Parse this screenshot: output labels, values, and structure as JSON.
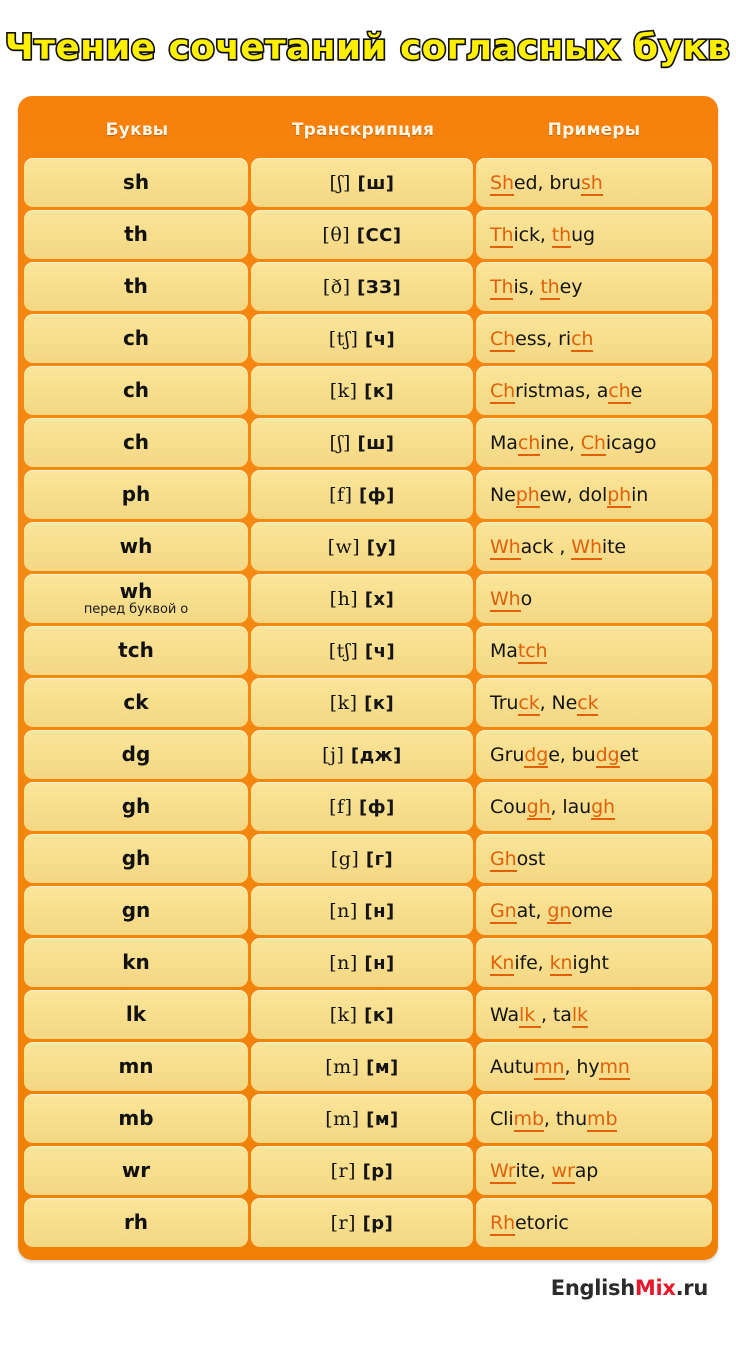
{
  "title": "Чтение сочетаний согласных букв",
  "colors": {
    "panel_orange": "#F6820D",
    "cell_yellow": "#F8E095",
    "highlight_orange": "#E2600A",
    "title_yellow": "#FFF000",
    "title_outline": "#111111",
    "brand_red": "#E8182B"
  },
  "table": {
    "headers": {
      "letters": "Буквы",
      "transcription": "Транскрипция",
      "examples": "Примеры"
    },
    "rows": [
      {
        "letters": "sh",
        "note": "",
        "ipa": "[ʃ]",
        "cyr": "[ш]",
        "example_parts": [
          {
            "t": "S",
            "hl": true
          },
          {
            "t": "h",
            "hl": true
          },
          {
            "t": "ed, bru",
            "hl": false
          },
          {
            "t": "sh",
            "hl": true
          }
        ],
        "example_plain": "Shed, brush"
      },
      {
        "letters": "th",
        "note": "",
        "ipa": "[θ]",
        "cyr": "[СС]",
        "example_parts": [
          {
            "t": "Th",
            "hl": true
          },
          {
            "t": "ick, ",
            "hl": false
          },
          {
            "t": "th",
            "hl": true
          },
          {
            "t": "ug",
            "hl": false
          }
        ],
        "example_plain": "Thick, thug"
      },
      {
        "letters": "th",
        "note": "",
        "ipa": "[ð]",
        "cyr": "[ЗЗ]",
        "example_parts": [
          {
            "t": "Th",
            "hl": true
          },
          {
            "t": "is, ",
            "hl": false
          },
          {
            "t": "th",
            "hl": true
          },
          {
            "t": "ey",
            "hl": false
          }
        ],
        "example_plain": "This, they"
      },
      {
        "letters": "ch",
        "note": "",
        "ipa": "[tʃ]",
        "cyr": "[ч]",
        "example_parts": [
          {
            "t": "Ch",
            "hl": true
          },
          {
            "t": "ess, ri",
            "hl": false
          },
          {
            "t": "ch",
            "hl": true
          }
        ],
        "example_plain": "Chess, rich"
      },
      {
        "letters": "ch",
        "note": "",
        "ipa": "[k]",
        "cyr": "[к]",
        "example_parts": [
          {
            "t": "Ch",
            "hl": true
          },
          {
            "t": "ristmas, a",
            "hl": false
          },
          {
            "t": "ch",
            "hl": true
          },
          {
            "t": "e",
            "hl": false
          }
        ],
        "example_plain": "Christmas, ache"
      },
      {
        "letters": "ch",
        "note": "",
        "ipa": "[ʃ]",
        "cyr": "[ш]",
        "example_parts": [
          {
            "t": "Ma",
            "hl": false
          },
          {
            "t": "ch",
            "hl": true
          },
          {
            "t": "ine, ",
            "hl": false
          },
          {
            "t": "Ch",
            "hl": true
          },
          {
            "t": "icago",
            "hl": false
          }
        ],
        "example_plain": "Machine, Chicago"
      },
      {
        "letters": "ph",
        "note": "",
        "ipa": "[f]",
        "cyr": "[ф]",
        "example_parts": [
          {
            "t": "Ne",
            "hl": false
          },
          {
            "t": "ph",
            "hl": true
          },
          {
            "t": "ew, dol",
            "hl": false
          },
          {
            "t": "ph",
            "hl": true
          },
          {
            "t": "in",
            "hl": false
          }
        ],
        "example_plain": "Nephew, dolphin"
      },
      {
        "letters": "wh",
        "note": "",
        "ipa": "[w]",
        "cyr": "[у]",
        "example_parts": [
          {
            "t": "Wh",
            "hl": true
          },
          {
            "t": "ack , ",
            "hl": false
          },
          {
            "t": "Wh",
            "hl": true
          },
          {
            "t": "ite",
            "hl": false
          }
        ],
        "example_plain": "Whack , White"
      },
      {
        "letters": "wh",
        "note": "перед буквой o",
        "ipa": "[h]",
        "cyr": "[х]",
        "example_parts": [
          {
            "t": "Wh",
            "hl": true
          },
          {
            "t": "o",
            "hl": false
          }
        ],
        "example_plain": "Who"
      },
      {
        "letters": "tch",
        "note": "",
        "ipa": "[tʃ]",
        "cyr": "[ч]",
        "example_parts": [
          {
            "t": "Ma",
            "hl": false
          },
          {
            "t": "tch",
            "hl": true
          }
        ],
        "example_plain": "Match"
      },
      {
        "letters": "ck",
        "note": "",
        "ipa": "[k]",
        "cyr": "[к]",
        "example_parts": [
          {
            "t": "Tru",
            "hl": false
          },
          {
            "t": "ck",
            "hl": true
          },
          {
            "t": ", Ne",
            "hl": false
          },
          {
            "t": "ck",
            "hl": true
          }
        ],
        "example_plain": "Truck, Neck"
      },
      {
        "letters": "dg",
        "note": "",
        "ipa": "[j]",
        "cyr": "[дж]",
        "example_parts": [
          {
            "t": "Gru",
            "hl": false
          },
          {
            "t": "dg",
            "hl": true
          },
          {
            "t": "e, bu",
            "hl": false
          },
          {
            "t": "dg",
            "hl": true
          },
          {
            "t": "et",
            "hl": false
          }
        ],
        "example_plain": "Grudge, budget"
      },
      {
        "letters": "gh",
        "note": "",
        "ipa": "[f]",
        "cyr": "[ф]",
        "example_parts": [
          {
            "t": "Cou",
            "hl": false
          },
          {
            "t": "gh",
            "hl": true
          },
          {
            "t": ", lau",
            "hl": false
          },
          {
            "t": "gh",
            "hl": true
          }
        ],
        "example_plain": "Cough, laugh"
      },
      {
        "letters": "gh",
        "note": "",
        "ipa": "[g]",
        "cyr": "[г]",
        "example_parts": [
          {
            "t": "Gh",
            "hl": true
          },
          {
            "t": "ost",
            "hl": false
          }
        ],
        "example_plain": "Ghost"
      },
      {
        "letters": "gn",
        "note": "",
        "ipa": "[n]",
        "cyr": "[н]",
        "example_parts": [
          {
            "t": "Gn",
            "hl": true
          },
          {
            "t": "at, ",
            "hl": false
          },
          {
            "t": "gn",
            "hl": true
          },
          {
            "t": "ome",
            "hl": false
          }
        ],
        "example_plain": "Gnat, gnome"
      },
      {
        "letters": "kn",
        "note": "",
        "ipa": "[n]",
        "cyr": "[н]",
        "example_parts": [
          {
            "t": "Kn",
            "hl": true
          },
          {
            "t": "ife, ",
            "hl": false
          },
          {
            "t": "kn",
            "hl": true
          },
          {
            "t": "ight",
            "hl": false
          }
        ],
        "example_plain": "Knife, knight"
      },
      {
        "letters": "lk",
        "note": "",
        "ipa": "[k]",
        "cyr": "[к]",
        "example_parts": [
          {
            "t": "Wa",
            "hl": false
          },
          {
            "t": "lk ",
            "hl": true
          },
          {
            "t": ", ta",
            "hl": false
          },
          {
            "t": "lk",
            "hl": true
          }
        ],
        "example_plain": "Walk , talk"
      },
      {
        "letters": "mn",
        "note": "",
        "ipa": "[m]",
        "cyr": "[м]",
        "example_parts": [
          {
            "t": "Autu",
            "hl": false
          },
          {
            "t": "mn",
            "hl": true
          },
          {
            "t": ", hy",
            "hl": false
          },
          {
            "t": "mn",
            "hl": true
          }
        ],
        "example_plain": "Autumn, hymn"
      },
      {
        "letters": "mb",
        "note": "",
        "ipa": "[m]",
        "cyr": "[м]",
        "example_parts": [
          {
            "t": "Cli",
            "hl": false
          },
          {
            "t": "mb",
            "hl": true
          },
          {
            "t": ", thu",
            "hl": false
          },
          {
            "t": "mb",
            "hl": true
          }
        ],
        "example_plain": "Climb, thumb"
      },
      {
        "letters": "wr",
        "note": "",
        "ipa": "[r]",
        "cyr": "[р]",
        "example_parts": [
          {
            "t": "Wr",
            "hl": true
          },
          {
            "t": "ite, ",
            "hl": false
          },
          {
            "t": "wr",
            "hl": true
          },
          {
            "t": "ap",
            "hl": false
          }
        ],
        "example_plain": "Write, wrap"
      },
      {
        "letters": "rh",
        "note": "",
        "ipa": "[r]",
        "cyr": "[р]",
        "example_parts": [
          {
            "t": "Rh",
            "hl": true
          },
          {
            "t": "etoric",
            "hl": false
          }
        ],
        "example_plain": "Rhetoric"
      }
    ]
  },
  "footer": {
    "brand_first": "English",
    "brand_mix": "Mix",
    "brand_tld": ".ru"
  }
}
